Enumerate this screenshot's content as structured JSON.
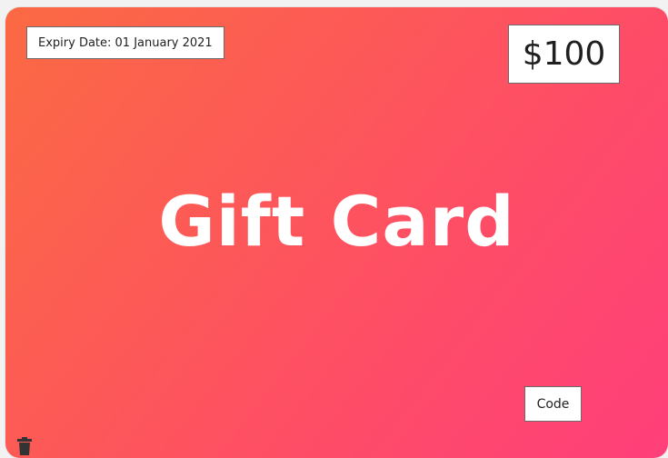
{
  "card": {
    "expiry_label": "Expiry Date: 01 January 2021",
    "amount": "$100",
    "title": "Gift Card",
    "code_button": "Code",
    "delete_icon": "trash-icon",
    "colors": {
      "gradient_start": "#fb6a43",
      "gradient_end": "#ff3f7a",
      "text_on_card": "#ffffff"
    }
  }
}
